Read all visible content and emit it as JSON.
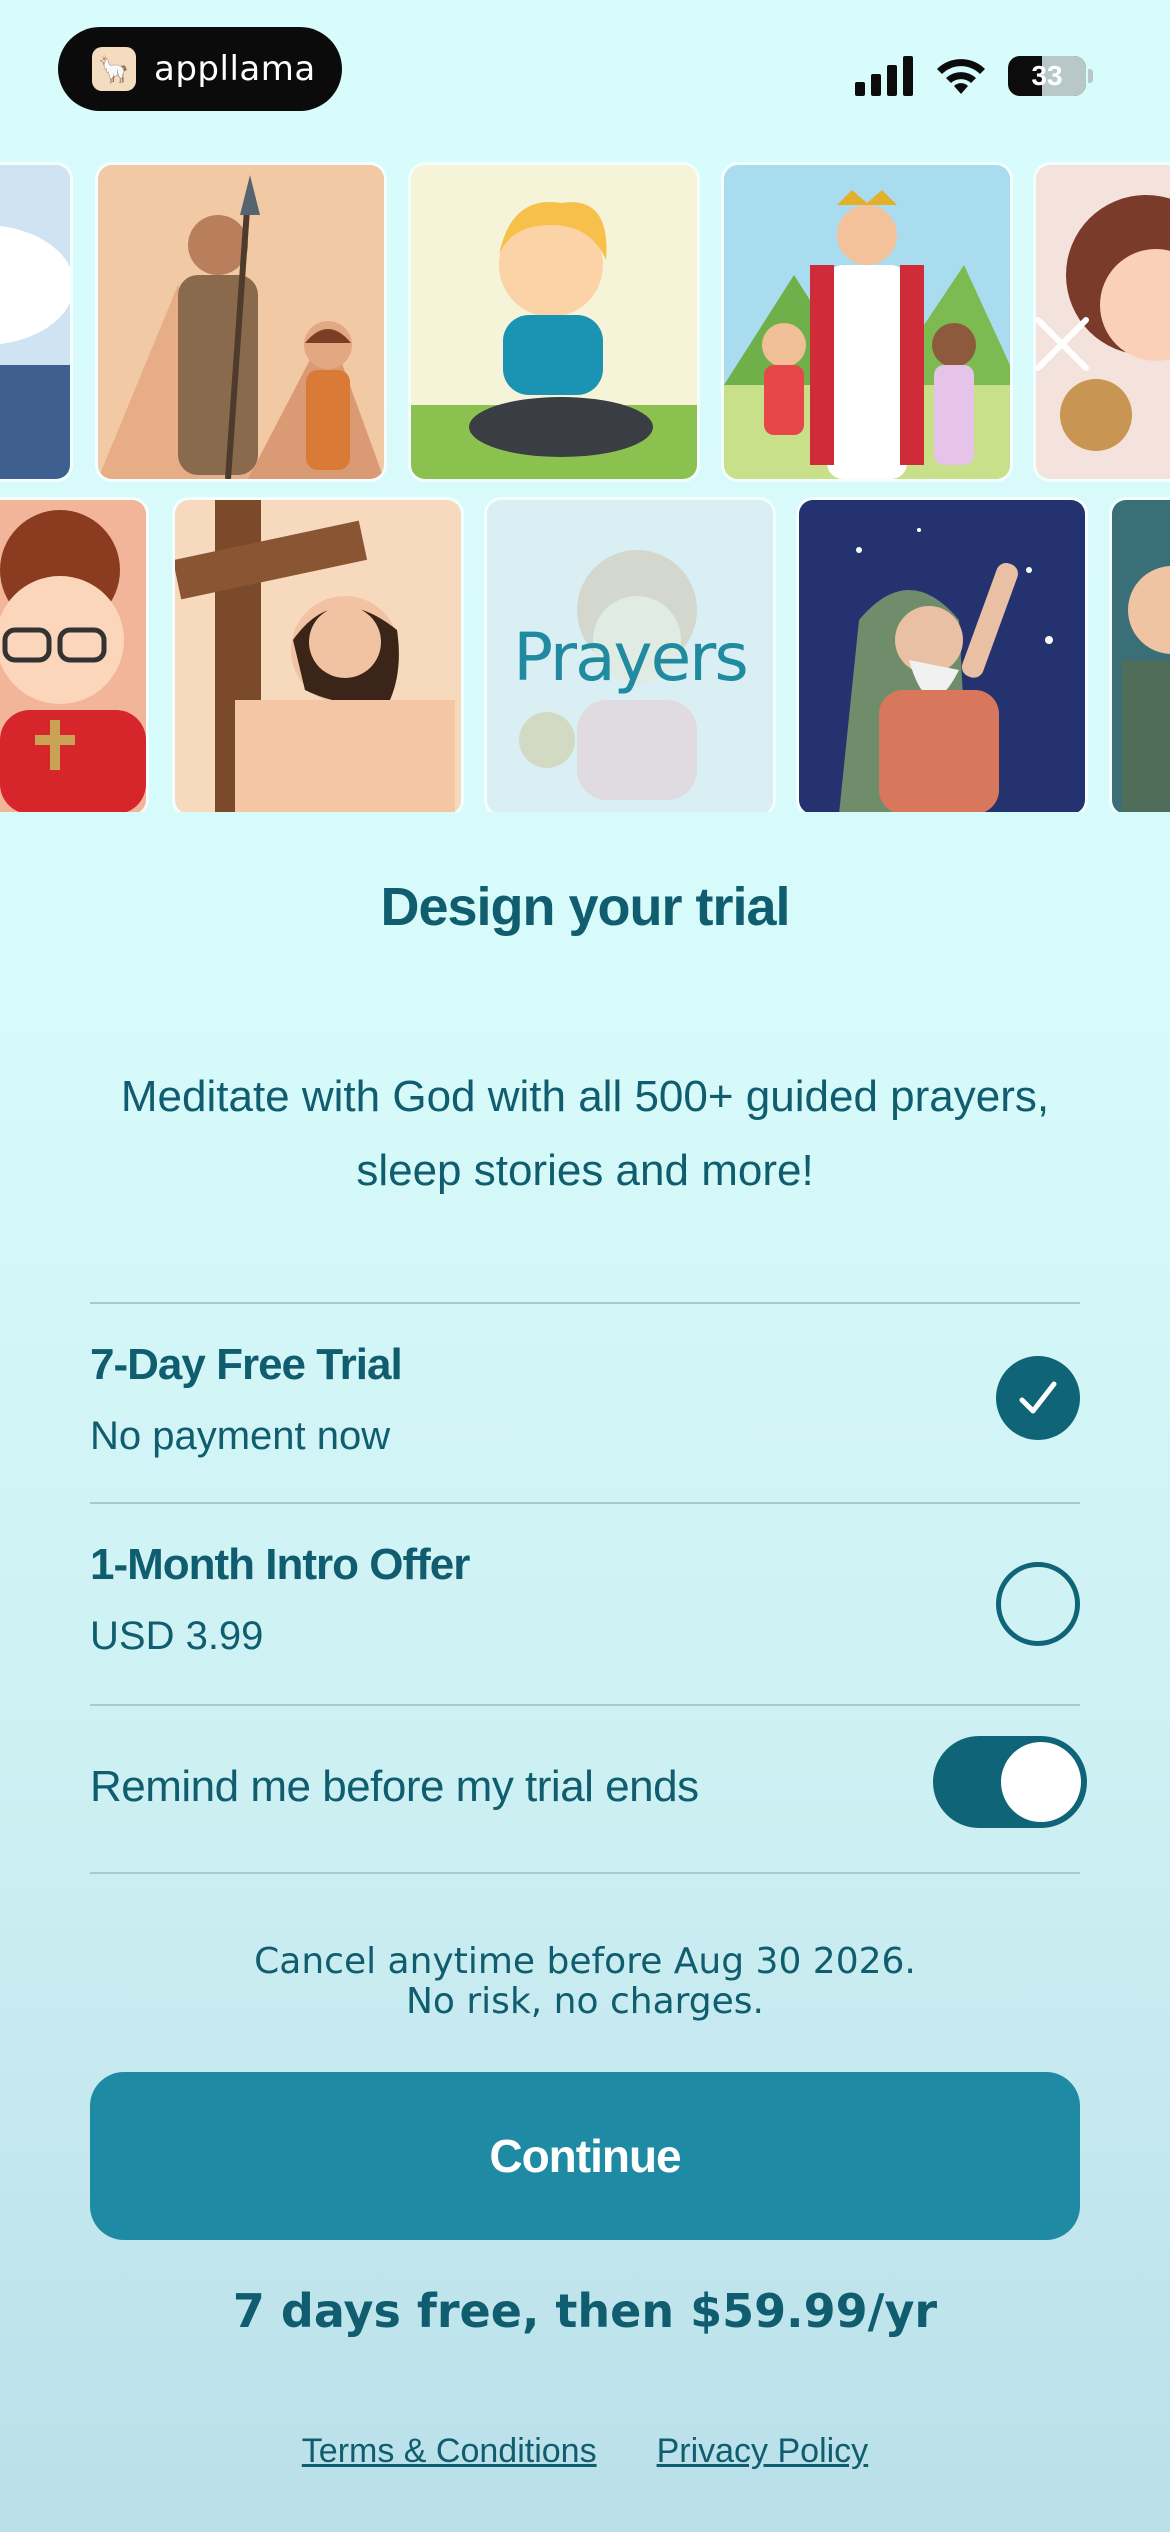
{
  "status_bar": {
    "app_name": "appllama",
    "app_logo_icon": "llama-icon",
    "battery_level": "33",
    "icons": [
      "cellular-signal-icon",
      "wifi-icon",
      "battery-icon"
    ]
  },
  "carousel": {
    "close_icon": "close-icon",
    "row1": [
      "angel-art",
      "warrior-boy-art",
      "praying-boy-art",
      "jesus-children-art",
      "sleeping-girl-art"
    ],
    "row2": [
      "glasses-boy-art",
      "crucifixion-art",
      "prayers-art",
      "prophet-night-art",
      "elder-art"
    ],
    "highlight_label": "Prayers"
  },
  "header": {
    "title": "Design your trial",
    "subtitle": "Meditate with God with all 500+ guided prayers, sleep stories and more!"
  },
  "options": [
    {
      "title": "7-Day Free Trial",
      "subtitle": "No payment now",
      "selected": true
    },
    {
      "title": "1-Month Intro Offer",
      "subtitle": "USD 3.99",
      "selected": false
    }
  ],
  "reminder": {
    "label": "Remind me before my trial ends",
    "enabled": true
  },
  "cancel_note": {
    "line1": "Cancel anytime before Aug 30 2026.",
    "line2": "No risk, no charges."
  },
  "cta": {
    "label": "Continue"
  },
  "price_line": "7 days free, then $59.99/yr",
  "footer": {
    "terms": "Terms & Conditions",
    "privacy": "Privacy Policy"
  },
  "colors": {
    "primary": "#0f6577",
    "button": "#1f8aa3",
    "text": "#0f5d6e",
    "background": "#d8fbfb"
  }
}
